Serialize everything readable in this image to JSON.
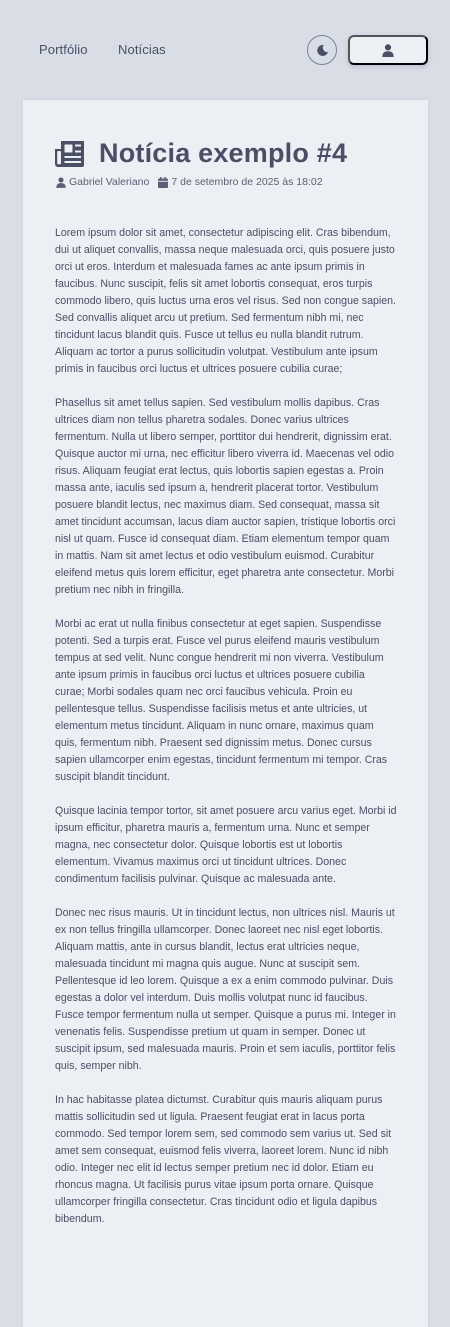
{
  "nav": {
    "portfolio": "Portfólio",
    "noticias": "Notícias"
  },
  "icons": {
    "theme": "moon-icon",
    "user": "user-icon",
    "title": "newspaper-icon",
    "author": "user-icon",
    "date": "calendar-icon"
  },
  "article": {
    "title": "Notícia exemplo #4",
    "author": "Gabriel Valeriano",
    "date": "7 de setembro de 2025 às 18:02",
    "paragraphs": [
      " Lorem ipsum dolor sit amet, consectetur adipiscing elit. Cras bibendum, dui ut aliquet convallis, massa neque malesuada orci, quis posuere justo orci ut eros. Interdum et malesuada fames ac ante ipsum primis in faucibus. Nunc suscipit, felis sit amet lobortis consequat, eros turpis commodo libero, quis luctus urna eros vel risus. Sed non congue sapien. Sed convallis aliquet arcu ut pretium. Sed fermentum nibh mi, nec tincidunt lacus blandit quis. Fusce ut tellus eu nulla blandit rutrum. Aliquam ac tortor a purus sollicitudin volutpat. Vestibulum ante ipsum primis in faucibus orci luctus et ultrices posuere cubilia curae;",
      "Phasellus sit amet tellus sapien. Sed vestibulum mollis dapibus. Cras ultrices diam non tellus pharetra sodales. Donec varius ultrices fermentum. Nulla ut libero semper, porttitor dui hendrerit, dignissim erat. Quisque auctor mi urna, nec efficitur libero viverra id. Maecenas vel odio risus. Aliquam feugiat erat lectus, quis lobortis sapien egestas a. Proin massa ante, iaculis sed ipsum a, hendrerit placerat tortor. Vestibulum posuere blandit lectus, nec maximus diam. Sed consequat, massa sit amet tincidunt accumsan, lacus diam auctor sapien, tristique lobortis orci nisl ut quam. Fusce id consequat diam. Etiam elementum tempor quam in mattis. Nam sit amet lectus et odio vestibulum euismod. Curabitur eleifend metus quis lorem efficitur, eget pharetra ante consectetur. Morbi pretium nec nibh in fringilla.",
      "Morbi ac erat ut nulla finibus consectetur at eget sapien. Suspendisse potenti. Sed a turpis erat. Fusce vel purus eleifend mauris vestibulum tempus at sed velit. Nunc congue hendrerit mi non viverra. Vestibulum ante ipsum primis in faucibus orci luctus et ultrices posuere cubilia curae; Morbi sodales quam nec orci faucibus vehicula. Proin eu pellentesque tellus. Suspendisse facilisis metus et ante ultricies, ut elementum metus tincidunt. Aliquam in nunc ornare, maximus quam quis, fermentum nibh. Praesent sed dignissim metus. Donec cursus sapien ullamcorper enim egestas, tincidunt fermentum mi tempor. Cras suscipit blandit tincidunt.",
      "Quisque lacinia tempor tortor, sit amet posuere arcu varius eget. Morbi id ipsum efficitur, pharetra mauris a, fermentum urna. Nunc et semper magna, nec consectetur dolor. Quisque lobortis est ut lobortis elementum. Vivamus maximus orci ut tincidunt ultrices. Donec condimentum facilisis pulvinar. Quisque ac malesuada ante.",
      "Donec nec risus mauris. Ut in tincidunt lectus, non ultrices nisl. Mauris ut ex non tellus fringilla ullamcorper. Donec laoreet nec nisl eget lobortis. Aliquam mattis, ante in cursus blandit, lectus erat ultricies neque, malesuada tincidunt mi magna quis augue. Nunc at suscipit sem. Pellentesque id leo lorem. Quisque a ex a enim commodo pulvinar. Duis egestas a dolor vel interdum. Duis mollis volutpat nunc id faucibus. Fusce tempor fermentum nulla ut semper. Quisque a purus mi. Integer in venenatis felis. Suspendisse pretium ut quam in semper. Donec ut suscipit ipsum, sed malesuada mauris. Proin et sem iaculis, porttitor felis quis, semper nibh.",
      "In hac habitasse platea dictumst. Curabitur quis mauris aliquam purus mattis sollicitudin sed ut ligula. Praesent feugiat erat in lacus porta commodo. Sed tempor lorem sem, sed commodo sem varius ut. Sed sit amet sem consequat, euismod felis viverra, laoreet lorem. Nunc id nibh odio. Integer nec elit id lectus semper pretium nec id dolor. Etiam eu rhoncus magna. Ut facilisis purus vitae ipsum porta ornare. Quisque ullamcorper fringilla consectetur. Cras tincidunt odio et ligula dapibus bibendum."
    ]
  }
}
